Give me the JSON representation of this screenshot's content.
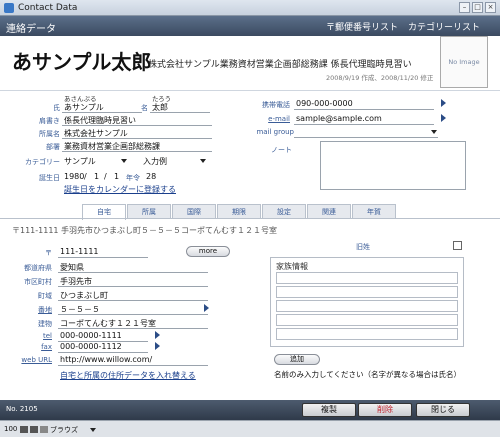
{
  "window": {
    "title": "Contact Data"
  },
  "header": {
    "section": "連絡データ",
    "postal_list": "〒郵便番号リスト",
    "category_list": "カテゴリーリスト"
  },
  "contact": {
    "display_name": "あサンプル太郎",
    "company_line": "株式会社サンプル業務資材営業企画部総務課 係長代理臨時見習い",
    "timestamps": "2008/9/19 作成、2008/11/20 修正",
    "photo_placeholder": "No Image"
  },
  "fields": {
    "last_name_ruby": "あさんぷる",
    "first_name_ruby": "たろう",
    "last_name_label": "氏",
    "last_name": "あサンプル",
    "first_name_label": "名",
    "first_name": "太郎",
    "title_label": "肩書き",
    "title": "係長代理臨時見習い",
    "company_label": "所属名",
    "company": "株式会社サンプル",
    "department_label": "部署",
    "department": "業務資材営業企画部総務課",
    "category_label": "カテゴリー",
    "category": "サンプル",
    "input_example": "入力例",
    "birthday_label": "誕生日",
    "birth_year": "1980",
    "birth_month": "1",
    "birth_day": "1",
    "age_label": "年令",
    "age": "28",
    "register_birthday_link": "誕生日をカレンダーに登録する",
    "mobile_label": "携帯電話",
    "mobile": "090-000-0000",
    "email_label": "e-mail",
    "email": "sample@sample.com",
    "mail_group_label": "mail group",
    "note_label": "ノート"
  },
  "tabs": [
    {
      "label": "自宅",
      "active": true
    },
    {
      "label": "所属",
      "active": false
    },
    {
      "label": "国際",
      "active": false
    },
    {
      "label": "期限",
      "active": false
    },
    {
      "label": "設定",
      "active": false
    },
    {
      "label": "関連",
      "active": false
    },
    {
      "label": "年賀",
      "active": false
    }
  ],
  "home": {
    "address_headline": "〒111-1111 手羽先市ひつまぶし町５－５－５コーポてんむす１２１号室",
    "zip_label": "〒",
    "zip": "111-1111",
    "more_button": "more",
    "prefecture_label": "都道府県",
    "prefecture": "愛知県",
    "city_label": "市区町村",
    "city": "手羽先市",
    "town_label": "町域",
    "town": "ひつまぶし町",
    "number_label": "番地",
    "number": "５－５－５",
    "building_label": "建物",
    "building": "コーポてんむす１２１号室",
    "tel_label": "tel",
    "tel": "000-0000-1111",
    "fax_label": "fax",
    "fax": "000-0000-1112",
    "web_label": "web URL",
    "web": "http://www.willow.com/",
    "swap_link": "自宅と所属の住所データを入れ替える",
    "old_address_label": "旧姓",
    "family_title": "家族情報",
    "add_button": "追加",
    "family_note": "名前のみ入力してください（名字が異なる場合は氏名）"
  },
  "footer": {
    "record_no": "No. 2105",
    "duplicate": "複製",
    "delete": "削除",
    "close": "閉じる"
  },
  "statusbar": {
    "zoom": "100",
    "mode": "ブラウズ"
  },
  "colors": {
    "header_bg": "#3b4a60",
    "label": "#3a5c97",
    "link": "#1a3f8c",
    "delete": "#c0202a"
  }
}
